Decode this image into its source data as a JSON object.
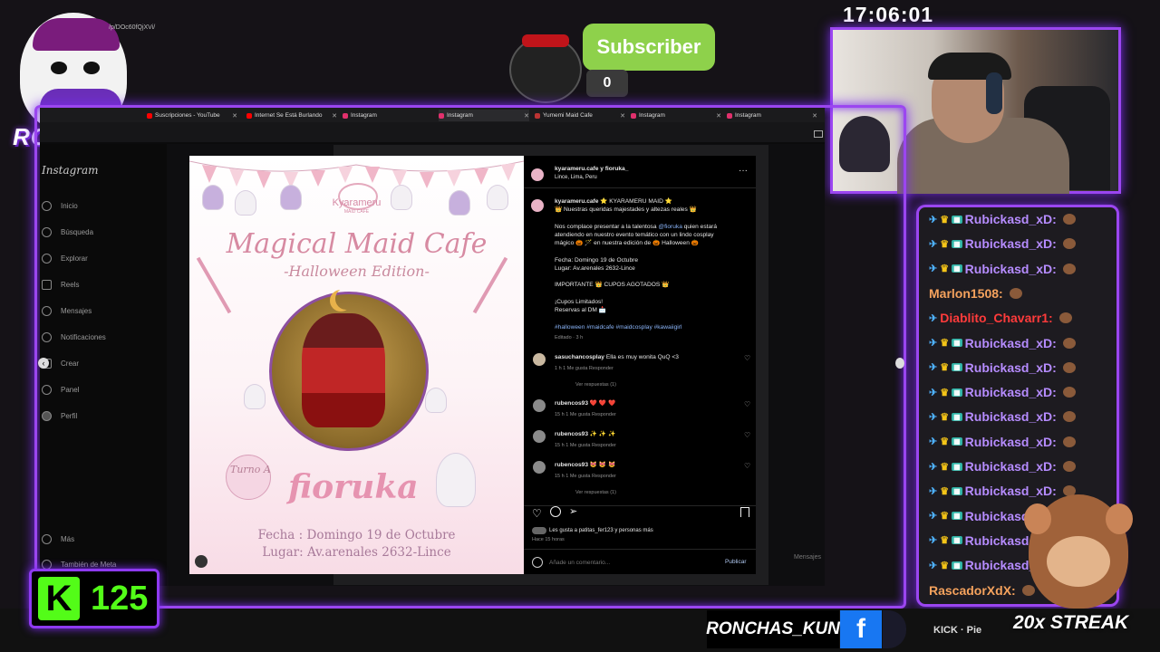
{
  "overlay": {
    "clock": "17:06:01",
    "logo_text": "RONCHAS",
    "subscribe_label": "Subscriber",
    "subscribe_count": "0",
    "kick_count": "125",
    "kick_letter": "K",
    "handle": "RONCHAS_KUN",
    "social_text": "KICK · Pie",
    "streak": "20x STREAK",
    "fb_letter": "f"
  },
  "browser": {
    "tabs": [
      {
        "label": "Suscripciones - YouTube",
        "color": "#ff0000"
      },
      {
        "label": "Internet Se Está Burlando",
        "color": "#ff0000"
      },
      {
        "label": "Instagram",
        "color": "#e1306c"
      },
      {
        "label": "Instagram",
        "color": "#e1306c"
      },
      {
        "label": "Yumemi Maid Cafe",
        "color": "#b33"
      },
      {
        "label": "Instagram",
        "color": "#e1306c"
      },
      {
        "label": "Instagram",
        "color": "#e1306c"
      }
    ],
    "url": "/p/DOc60fQjXVi/"
  },
  "instagram": {
    "logo": "Instagram",
    "nav": [
      "Inicio",
      "Búsqueda",
      "Explorar",
      "Reels",
      "Mensajes",
      "Notificaciones",
      "Crear",
      "Panel",
      "Perfil"
    ],
    "more": "Más",
    "meta": "También de Meta",
    "messages_label": "Mensajes"
  },
  "poster": {
    "brand": "Kyarameru",
    "brand_sub": "MAID CAFE",
    "title": "Magical Maid Cafe",
    "subtitle": "-Halloween Edition-",
    "turno": "Turno A",
    "name": "fioruka",
    "line1": "Fecha : Domingo 19 de Octubre",
    "line2": "Lugar: Av.arenales 2632-Lince"
  },
  "post": {
    "header_user": "kyarameru.cafe y fioruka_",
    "location": "Lince, Lima, Peru",
    "caption_user": "kyarameru.cafe",
    "caption_l1": "⭐ KYARAMERU MAID ⭐",
    "caption_l2": "👑 Nuestras queridas majestades y altezas reales 👑",
    "caption_l3": "Nos complace presentar a la talentosa",
    "mention": "@fioruka",
    "caption_l3b": "quien estará",
    "caption_l4": "atendiendo en nuestro evento temático con un lindo cosplay",
    "caption_l5": "mágico 🎃 🪄 en nuestra edición de 🎃 Halloween 🎃",
    "fecha": "Fecha: Domingo 19 de Octubre",
    "lugar": "Lugar: Av.arenales 2632-Lince",
    "importante": "IMPORTANTE 👑 CUPOS AGOTADOS 👑",
    "cupos": "¡Cupos Limitados!",
    "reservas": "Reservas al DM 📩",
    "hashtags": "#halloween #maidcafe #maidcosplay #kawaiigirl",
    "edited": "Editado · 3 h",
    "comments": [
      {
        "user": "sasuchancosplay",
        "text": "Ella es muy wonita QuQ <3",
        "meta": "1 h   1 Me gusta   Responder",
        "replies": "Ver respuestas (1)"
      },
      {
        "user": "rubencos93",
        "text": "❤️ ❤️ ❤️",
        "meta": "15 h   1 Me gusta   Responder",
        "replies": ""
      },
      {
        "user": "rubencos93",
        "text": "✨ ✨ ✨",
        "meta": "15 h   1 Me gusta   Responder",
        "replies": ""
      },
      {
        "user": "rubencos93",
        "text": "😻 😻 😻",
        "meta": "15 h   1 Me gusta   Responder",
        "replies": "Ver respuestas (1)"
      }
    ],
    "likes": "Les gusta a patitas_fer123 y personas más",
    "time": "Hace 15 horas",
    "comment_placeholder": "Añade un comentario...",
    "publish": "Publicar"
  },
  "chat": [
    {
      "name": "Rubickasd_xD:",
      "color": "#b68cff"
    },
    {
      "name": "Rubickasd_xD:",
      "color": "#b68cff"
    },
    {
      "name": "Rubickasd_xD:",
      "color": "#b68cff"
    },
    {
      "name": "Marlon1508:",
      "color": "#f5a25d"
    },
    {
      "name": "Diablito_Chavarr1:",
      "color": "#ff3b3b"
    },
    {
      "name": "Rubickasd_xD:",
      "color": "#b68cff"
    },
    {
      "name": "Rubickasd_xD:",
      "color": "#b68cff"
    },
    {
      "name": "Rubickasd_xD:",
      "color": "#b68cff"
    },
    {
      "name": "Rubickasd_xD:",
      "color": "#b68cff"
    },
    {
      "name": "Rubickasd_xD:",
      "color": "#b68cff"
    },
    {
      "name": "Rubickasd_xD:",
      "color": "#b68cff"
    },
    {
      "name": "Rubickasd_xD:",
      "color": "#b68cff"
    },
    {
      "name": "Rubickasd_xD:",
      "color": "#b68cff"
    },
    {
      "name": "Rubickasd_xD:",
      "color": "#b68cff"
    },
    {
      "name": "Rubickasd_xD:",
      "color": "#b68cff"
    },
    {
      "name": "RascadorXdX:",
      "color": "#f5a25d"
    }
  ]
}
